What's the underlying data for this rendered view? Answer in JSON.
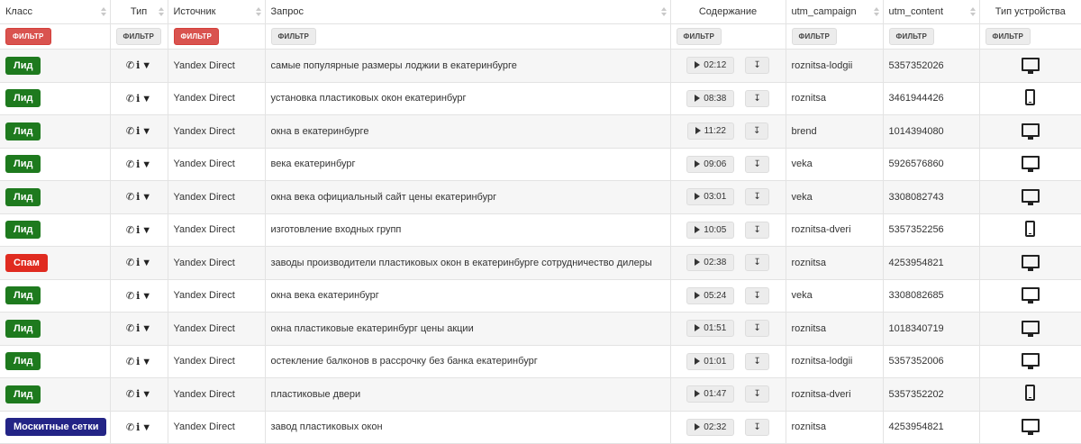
{
  "colors": {
    "lead": "#1e7a1e",
    "spam": "#e02b20",
    "mosquito": "#232486",
    "filter_active": "#d9534f"
  },
  "headers": {
    "class": "Класс",
    "type": "Тип",
    "source": "Источник",
    "query": "Запрос",
    "content": "Содержание",
    "utm_campaign": "utm_campaign",
    "utm_content": "utm_content",
    "device_type": "Тип устройства"
  },
  "filters": {
    "label": "ФИЛЬТР"
  },
  "rows": [
    {
      "class": "Лид",
      "class_color": "lead",
      "source": "Yandex Direct",
      "query": "самые популярные размеры лоджии в екатеринбурге",
      "duration": "02:12",
      "campaign": "roznitsa-lodgii",
      "content": "5357352026",
      "device": "monitor-icon"
    },
    {
      "class": "Лид",
      "class_color": "lead",
      "source": "Yandex Direct",
      "query": "установка пластиковых окон екатеринбург",
      "duration": "08:38",
      "campaign": "roznitsa",
      "content": "3461944426",
      "device": "phone-icon"
    },
    {
      "class": "Лид",
      "class_color": "lead",
      "source": "Yandex Direct",
      "query": "окна в екатеринбурге",
      "duration": "11:22",
      "campaign": "brend",
      "content": "1014394080",
      "device": "monitor-icon"
    },
    {
      "class": "Лид",
      "class_color": "lead",
      "source": "Yandex Direct",
      "query": "века екатеринбург",
      "duration": "09:06",
      "campaign": "veka",
      "content": "5926576860",
      "device": "monitor-icon"
    },
    {
      "class": "Лид",
      "class_color": "lead",
      "source": "Yandex Direct",
      "query": "окна века официальный сайт цены екатеринбург",
      "duration": "03:01",
      "campaign": "veka",
      "content": "3308082743",
      "device": "monitor-icon"
    },
    {
      "class": "Лид",
      "class_color": "lead",
      "source": "Yandex Direct",
      "query": "изготовление входных групп",
      "duration": "10:05",
      "campaign": "roznitsa-dveri",
      "content": "5357352256",
      "device": "phone-icon"
    },
    {
      "class": "Спам",
      "class_color": "spam",
      "source": "Yandex Direct",
      "query": "заводы производители пластиковых окон в екатеринбурге сотрудничество дилеры",
      "duration": "02:38",
      "campaign": "roznitsa",
      "content": "4253954821",
      "device": "monitor-icon"
    },
    {
      "class": "Лид",
      "class_color": "lead",
      "source": "Yandex Direct",
      "query": "окна века екатеринбург",
      "duration": "05:24",
      "campaign": "veka",
      "content": "3308082685",
      "device": "monitor-icon"
    },
    {
      "class": "Лид",
      "class_color": "lead",
      "source": "Yandex Direct",
      "query": "окна пластиковые екатеринбург цены акции",
      "duration": "01:51",
      "campaign": "roznitsa",
      "content": "1018340719",
      "device": "monitor-icon"
    },
    {
      "class": "Лид",
      "class_color": "lead",
      "source": "Yandex Direct",
      "query": "остекление балконов в рассрочку без банка екатеринбург",
      "duration": "01:01",
      "campaign": "roznitsa-lodgii",
      "content": "5357352006",
      "device": "monitor-icon"
    },
    {
      "class": "Лид",
      "class_color": "lead",
      "source": "Yandex Direct",
      "query": "пластиковые двери",
      "duration": "01:47",
      "campaign": "roznitsa-dveri",
      "content": "5357352202",
      "device": "phone-icon"
    },
    {
      "class": "Москитные сетки",
      "class_color": "mosquito",
      "source": "Yandex Direct",
      "query": "завод пластиковых окон",
      "duration": "02:32",
      "campaign": "roznitsa",
      "content": "4253954821",
      "device": "monitor-icon"
    }
  ]
}
